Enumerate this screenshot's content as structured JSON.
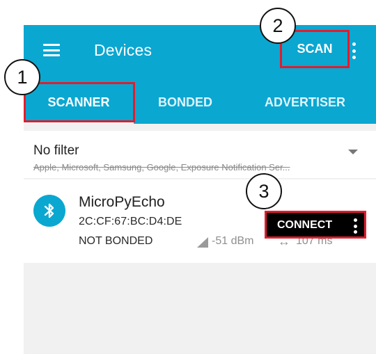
{
  "app": {
    "title": "Devices",
    "scan_label": "SCAN"
  },
  "tabs": [
    {
      "label": "SCANNER"
    },
    {
      "label": "BONDED"
    },
    {
      "label": "ADVERTISER"
    }
  ],
  "filter": {
    "title": "No filter",
    "subtitle": "Apple, Microsoft, Samsung, Google, Exposure Notification Ser..."
  },
  "device": {
    "name": "MicroPyEcho",
    "address": "2C:CF:67:BC:D4:DE",
    "bond_status": "NOT BONDED",
    "rssi": "-51 dBm",
    "interval": "107 ms",
    "connect_label": "CONNECT"
  },
  "annotations": {
    "one": "1",
    "two": "2",
    "three": "3"
  },
  "colors": {
    "primary": "#0aa7d1",
    "highlight": "#e11d2d"
  },
  "icons": {
    "menu": "menu-icon",
    "overflow": "overflow-icon",
    "dropdown": "chevron-down-icon",
    "bluetooth": "bluetooth-icon",
    "signal": "signal-icon",
    "interval": "arrow-left-right-icon"
  }
}
